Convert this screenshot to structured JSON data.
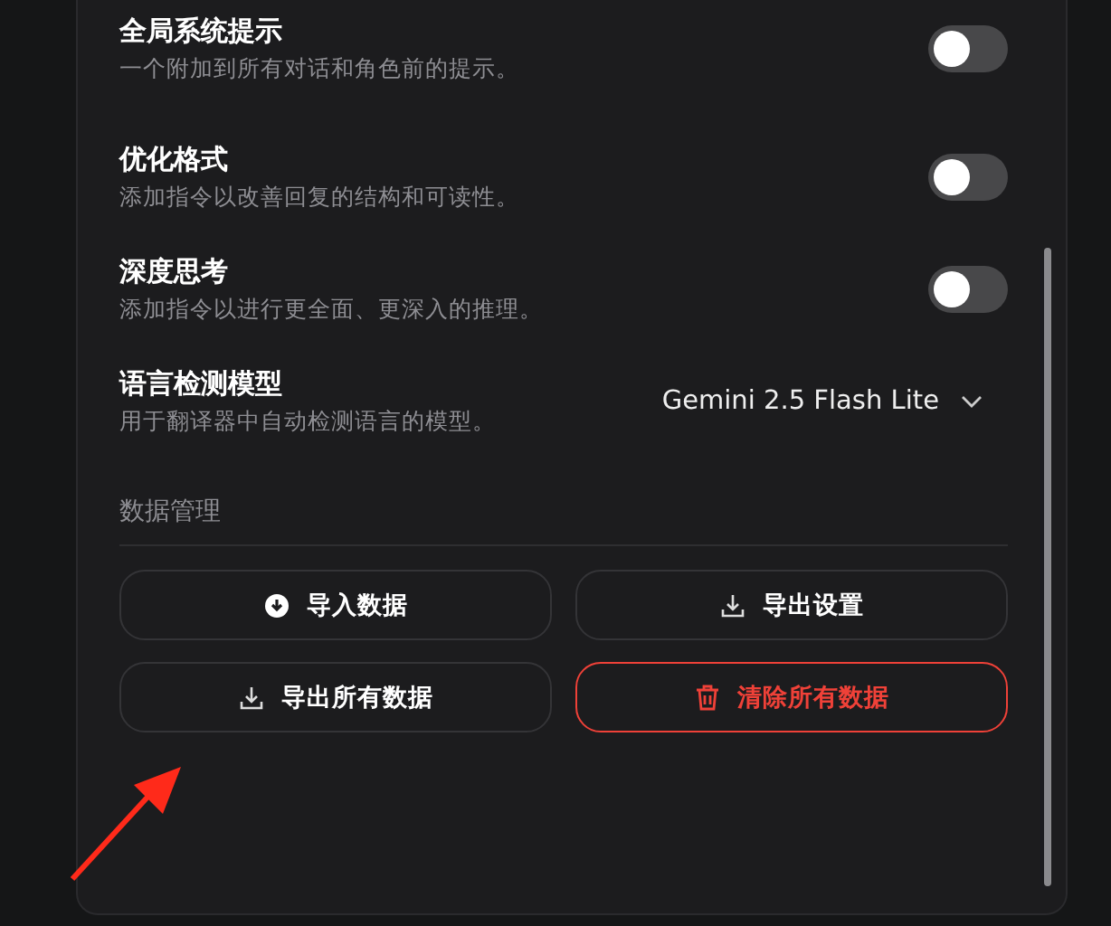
{
  "settings": [
    {
      "kind": "toggle",
      "title": "全局系统提示",
      "description": "一个附加到所有对话和角色前的提示。",
      "on": false
    },
    {
      "kind": "toggle",
      "title": "优化格式",
      "description": "添加指令以改善回复的结构和可读性。",
      "on": false
    },
    {
      "kind": "toggle",
      "title": "深度思考",
      "description": "添加指令以进行更全面、更深入的推理。",
      "on": false
    },
    {
      "kind": "select",
      "title": "语言检测模型",
      "description": "用于翻译器中自动检测语言的模型。",
      "value": "Gemini 2.5 Flash Lite"
    }
  ],
  "data_management": {
    "heading": "数据管理",
    "buttons": [
      {
        "label": "导入数据",
        "kind": "import"
      },
      {
        "label": "导出设置",
        "kind": "export"
      },
      {
        "label": "导出所有数据",
        "kind": "export"
      },
      {
        "label": "清除所有数据",
        "kind": "danger"
      }
    ]
  }
}
